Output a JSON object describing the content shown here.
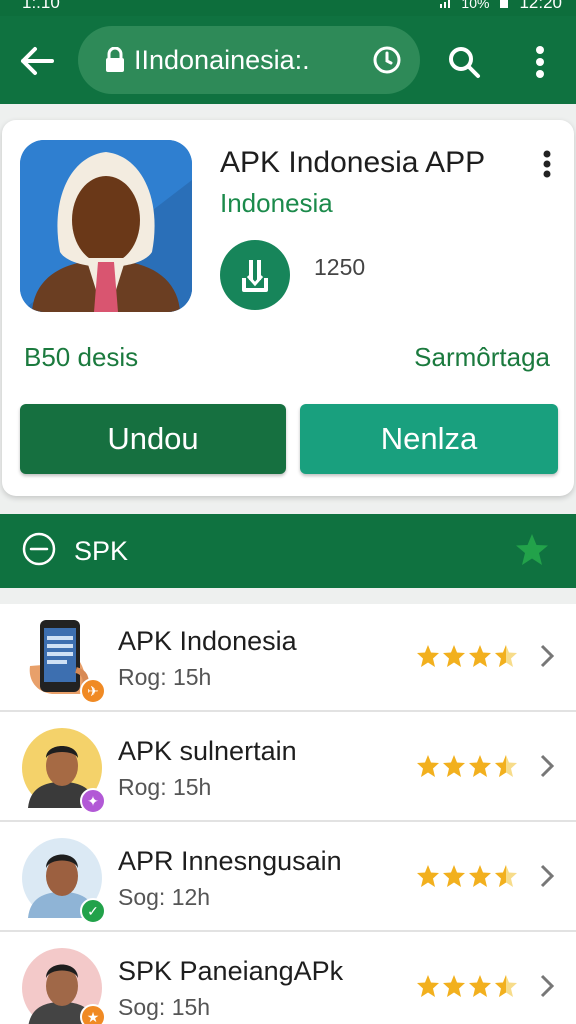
{
  "status_bar": {
    "time_left": "1:.10",
    "battery": "10%",
    "time_right": "12:20"
  },
  "app_bar": {
    "url": "IIndonainesia:."
  },
  "app_card": {
    "title": "APK Indonesia APP",
    "subtitle": "Indonesia",
    "downloads": "1250",
    "left_meta": "B50 desis",
    "right_meta": "Sarmôrtaga",
    "primary_button": "Undou",
    "secondary_button": "Nenlza"
  },
  "section": {
    "title": "SPK"
  },
  "list": [
    {
      "name": "APK Indonesia",
      "meta": "Rog: 15h",
      "rating": 3.5,
      "avatar": "phone-icon",
      "badge": "orange"
    },
    {
      "name": "APK sulnertain",
      "meta": "Rog: 15h",
      "rating": 3.5,
      "avatar": "man-avatar",
      "badge": "purple"
    },
    {
      "name": "APR Innesngusain",
      "meta": "Sog: 12h",
      "rating": 3.5,
      "avatar": "man-avatar",
      "badge": "green"
    },
    {
      "name": "SPK PaneiangAPk",
      "meta": "Sog: 15h",
      "rating": 3.5,
      "avatar": "man-avatar",
      "badge": "orange"
    }
  ],
  "colors": {
    "primary": "#0f7240",
    "accent": "#19a07e",
    "star": "#f2b01e"
  }
}
